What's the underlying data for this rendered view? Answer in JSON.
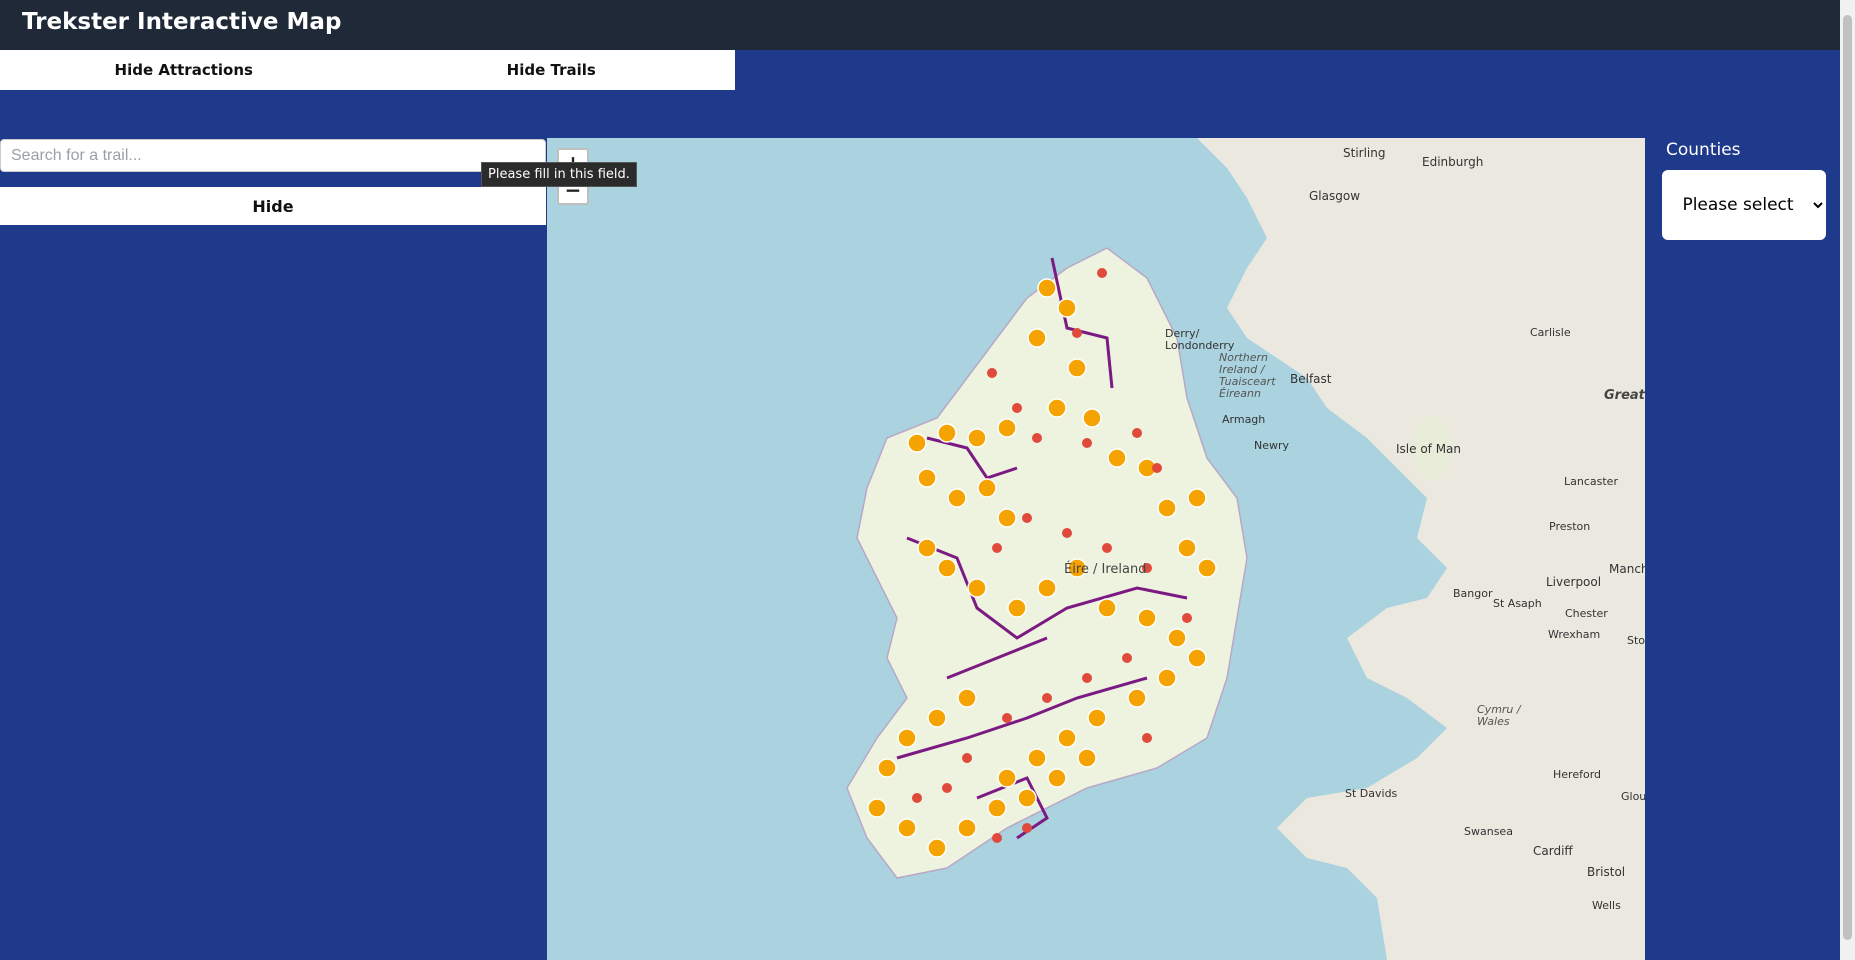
{
  "app": {
    "title": "Trekster Interactive Map"
  },
  "toggles": {
    "attractions": "Hide Attractions",
    "trails": "Hide Trails"
  },
  "search": {
    "placeholder": "Search for a trail...",
    "value": ""
  },
  "tooltip": {
    "text": "Please fill in this field."
  },
  "panel": {
    "hide_label": "Hide"
  },
  "map": {
    "zoom_in": "+",
    "zoom_out": "−",
    "labels": {
      "stirling": "Stirling",
      "edinburgh": "Edinburgh",
      "glasgow": "Glasgow",
      "derry": "Derry/\nLondonderry",
      "northern_ireland": "Northern\nIreland /\nTuaisceart\nÉireann",
      "belfast": "Belfast",
      "armagh": "Armagh",
      "newry": "Newry",
      "isle_of_man": "Isle of Man",
      "eire": "Éire / Ireland",
      "carlisle": "Carlisle",
      "great": "Great",
      "lancaster": "Lancaster",
      "preston": "Preston",
      "liverpool": "Liverpool",
      "manchester": "Manch",
      "bangor": "Bangor",
      "st_asaph": "St Asaph",
      "chester": "Chester",
      "wrexham": "Wrexham",
      "stoke": "Stok",
      "cymru": "Cymru /\nWales",
      "hereford": "Hereford",
      "gloucester": "Glouce",
      "st_davids": "St Davids",
      "swansea": "Swansea",
      "cardiff": "Cardiff",
      "bristol": "Bristol",
      "wells": "Wells"
    },
    "colors": {
      "sea": "#aad3df",
      "land": "#f2efe9",
      "trail": "#7b1a82",
      "marker_trail": "#f5a300",
      "marker_attraction": "#e04a3c"
    },
    "icons": {
      "trail_marker": "hiker-marker-icon",
      "attraction_marker": "map-pin-icon"
    }
  },
  "counties": {
    "label": "Counties",
    "selected": "Please select"
  }
}
